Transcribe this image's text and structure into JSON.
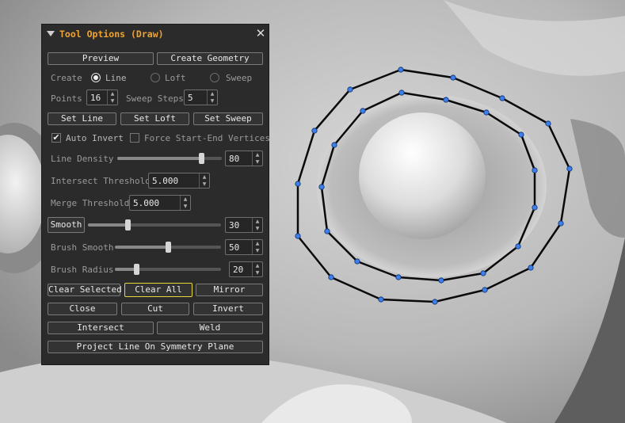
{
  "panel": {
    "title": "Tool Options (Draw)",
    "preview_label": "Preview",
    "create_geometry_label": "Create Geometry",
    "create_label": "Create",
    "create_options": [
      "Line",
      "Loft",
      "Sweep"
    ],
    "create_selected": "Line",
    "points_label": "Points",
    "points_value": "16",
    "sweep_steps_label": "Sweep Steps",
    "sweep_steps_value": "5",
    "set_line_label": "Set Line",
    "set_loft_label": "Set Loft",
    "set_sweep_label": "Set Sweep",
    "auto_invert_label": "Auto Invert",
    "auto_invert_checked": true,
    "force_vertices_label": "Force Start-End Vertices",
    "force_vertices_checked": false,
    "line_density_label": "Line Density",
    "line_density_value": "80",
    "line_density_level": 0.8,
    "intersect_threshold_label": "Intersect Threshold",
    "intersect_threshold_value": "5.000",
    "merge_threshold_label": "Merge Threshold",
    "merge_threshold_value": "5.000",
    "smooth_label": "Smooth",
    "smooth_value": "30",
    "smooth_level": 0.3,
    "brush_smooth_label": "Brush Smooth",
    "brush_smooth_value": "50",
    "brush_smooth_level": 0.5,
    "brush_radius_label": "Brush Radius",
    "brush_radius_value": "20",
    "brush_radius_level": 0.2,
    "clear_selected_label": "Clear Selected",
    "clear_all_label": "Clear All",
    "mirror_label": "Mirror",
    "close_label": "Close",
    "cut_label": "Cut",
    "invert_label": "Invert",
    "intersect_label": "Intersect",
    "weld_label": "Weld",
    "project_line_label": "Project Line On Symmetry Plane"
  },
  "colors": {
    "title_accent": "#f0a330",
    "highlight_border": "#e8d63c",
    "curve_point": "#3f7fe8",
    "curve_line": "#0a0a0a"
  }
}
